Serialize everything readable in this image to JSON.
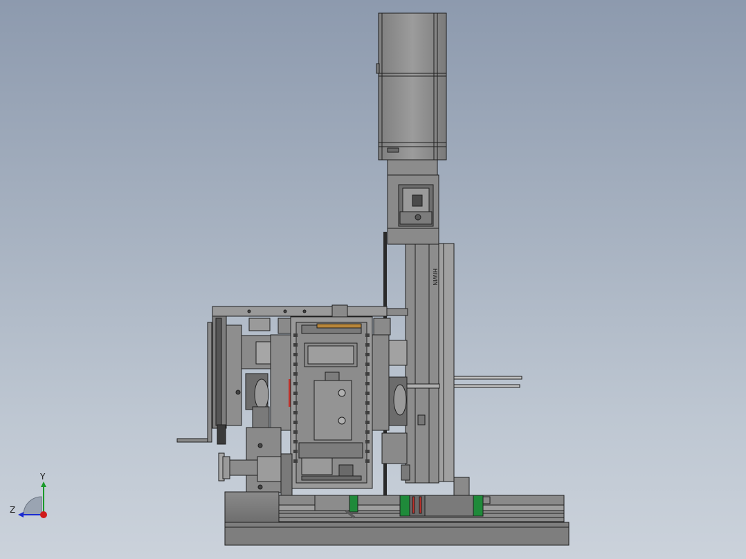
{
  "viewport": {
    "background_top": "#8d9aae",
    "background_bottom": "#cbd2db"
  },
  "model": {
    "part_color": "#8f8f8f",
    "edge_color": "#1e1e1e",
    "dark_part_color": "#5a5a5a",
    "rail_accent_color": "#1f8a3a",
    "red_accent_color": "#c0302a",
    "motor_label": "",
    "rail_brand_text": "HIWIN"
  },
  "triad": {
    "y_label": "Y",
    "z_label": "Z",
    "y_color": "#1a9a2a",
    "z_color": "#1a2ad0",
    "origin_color": "#d01a1a"
  }
}
